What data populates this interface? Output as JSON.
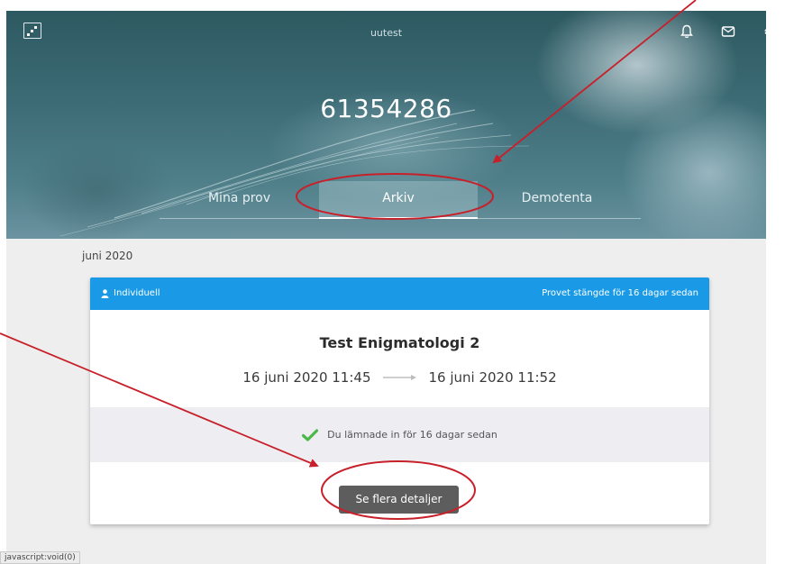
{
  "header": {
    "app_name": "uutest",
    "user_number": "61354286",
    "icons": [
      "logo-icon",
      "bell-icon",
      "mail-icon",
      "gear-icon"
    ]
  },
  "tabs": [
    {
      "label": "Mina prov",
      "active": false
    },
    {
      "label": "Arkiv",
      "active": true
    },
    {
      "label": "Demotenta",
      "active": false
    }
  ],
  "archive": {
    "month": "juni 2020",
    "card": {
      "type_label": "Individuell",
      "status": "Provet stängde för 16 dagar sedan",
      "title": "Test Enigmatologi 2",
      "start": "16 juni 2020 11:45",
      "end": "16 juni 2020 11:52",
      "submitted": "Du lämnade in för 16 dagar sedan",
      "details_button": "Se flera detaljer"
    }
  },
  "statusbar": {
    "text": "javascript:void(0)"
  },
  "colors": {
    "accent": "#1a9ae6",
    "check": "#4cb848",
    "button": "#5d5d5d",
    "annotation": "#c8202a"
  }
}
